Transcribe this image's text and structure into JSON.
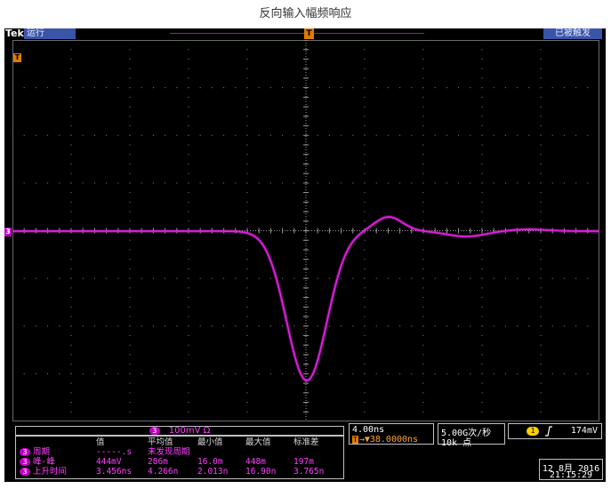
{
  "page_title": "反向输入幅频响应",
  "topbar": {
    "brand": "Tek",
    "run_status": "运行",
    "trigger_position_marker": "T",
    "trigger_state": "已被触发"
  },
  "markers": {
    "trigger_level": "T",
    "channel_ref": "3"
  },
  "channel": {
    "number": "3",
    "scale": "100mV",
    "coupling_symbol": "Ω",
    "trace_color": "#e020e0"
  },
  "measurements": {
    "headers": {
      "value": "值",
      "mean": "平均值",
      "min": "最小值",
      "max": "最大值",
      "std": "标准差"
    },
    "rows": [
      {
        "channel": "3",
        "label": "周期",
        "value": "-----.s",
        "mean": "未发现周期",
        "min": "",
        "max": "",
        "std": ""
      },
      {
        "channel": "3",
        "label": "峰-峰",
        "value": "444mV",
        "mean": "286m",
        "min": "16.0m",
        "max": "448m",
        "std": "197m"
      },
      {
        "channel": "3",
        "label": "上升时间",
        "value": "3.456ns",
        "mean": "4.266n",
        "min": "2.013n",
        "max": "16.90n",
        "std": "3.765n"
      }
    ]
  },
  "timebase": {
    "scale": "4.00ns",
    "marker": "T",
    "delay": "→▼38.0000ns"
  },
  "acquisition": {
    "sample_rate": "5.00G次/秒",
    "record_length": "10k 点"
  },
  "trigger": {
    "source": "1",
    "slope_icon": "rising-edge-icon",
    "level": "174mV"
  },
  "clock": {
    "date": "12 8月  2016",
    "time": "21:15:29"
  },
  "colors": {
    "background": "#000000",
    "trace": "#e020e0",
    "grid_dots": "#8a8a8a",
    "status_blue": "#3a55a8",
    "trigger_orange": "#e07b00"
  }
}
